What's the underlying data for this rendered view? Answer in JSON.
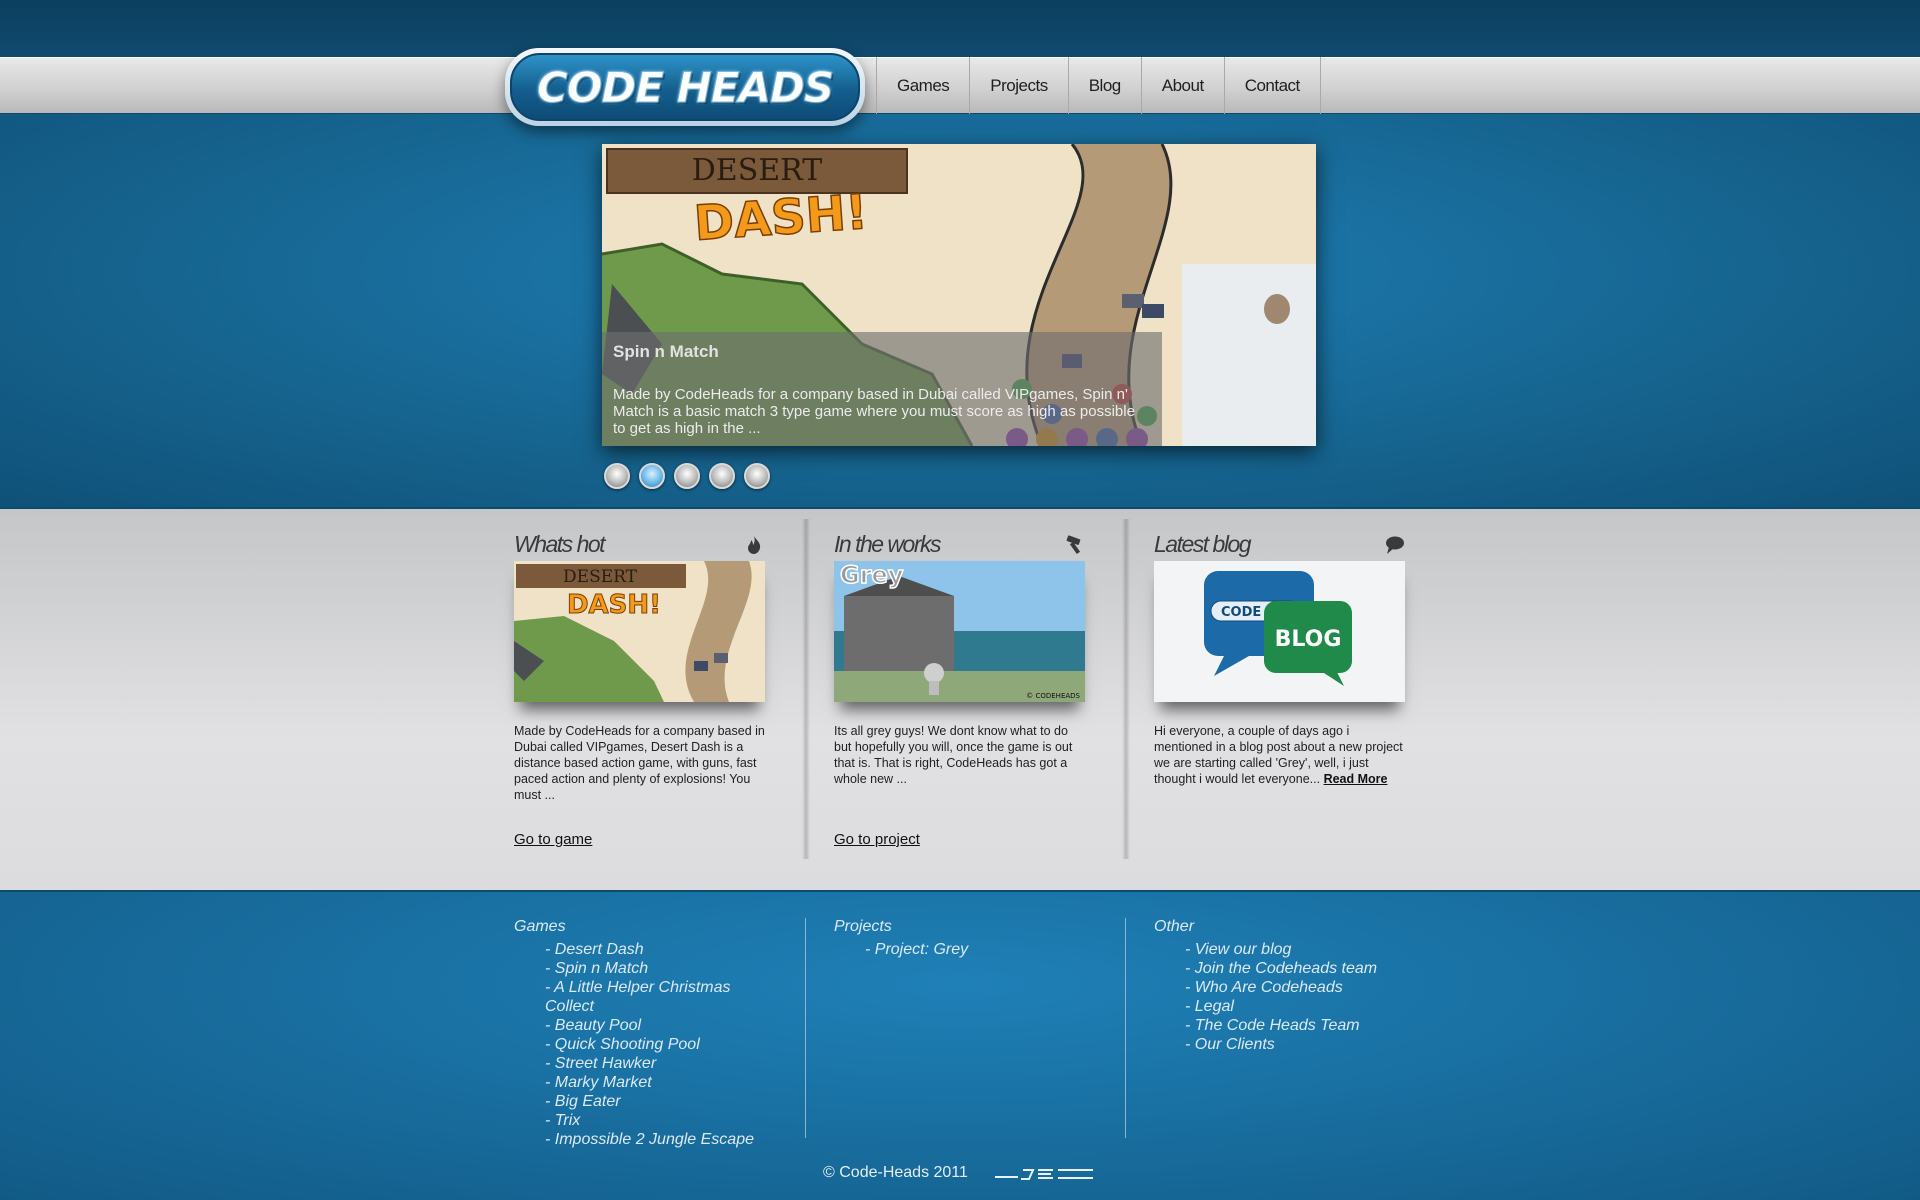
{
  "site": {
    "logo_text": "CODE HEADS"
  },
  "nav": [
    {
      "label": "Games"
    },
    {
      "label": "Projects"
    },
    {
      "label": "Blog"
    },
    {
      "label": "About"
    },
    {
      "label": "Contact"
    }
  ],
  "slider": {
    "image_title_1": "DESERT",
    "image_title_2": "DASH!",
    "caption_title": "Spin n Match",
    "caption_desc": "Made by CodeHeads for a company based in Dubai called VIPgames, Spin n' Match is a basic match 3 type game where you must score as high as possible to get as high in the ...",
    "dot_count": 5,
    "active_dot_index": 1
  },
  "columns": [
    {
      "title": "Whats hot",
      "icon": "flame-icon",
      "thumb_text_1": "DESERT",
      "thumb_text_2": "DASH!",
      "text": "Made by CodeHeads for a company based in Dubai called VIPgames, Desert Dash is a distance based action game, with guns, fast paced action and plenty of explosions! You must ...",
      "link": "Go to game"
    },
    {
      "title": "In the works",
      "icon": "hammer-icon",
      "thumb_text": "Grey",
      "thumb_credit": "© CODEHEADS",
      "text": "Its all grey guys! We dont know what to do but hopefully you will, once the game is out that is. That is right, CodeHeads has got a whole new ...",
      "link": "Go to project"
    },
    {
      "title": "Latest blog",
      "icon": "speech-bubble-icon",
      "thumb_text_1": "CODE H",
      "thumb_text_2": "BLOG",
      "text": "Hi everyone, a couple of days ago i mentioned in a blog post about a new project we are starting called 'Grey', well, i just thought i would let everyone...",
      "read_more": "Read More"
    }
  ],
  "footer": {
    "games": {
      "title": "Games",
      "items": [
        "- Desert Dash",
        "- Spin n Match",
        "- A Little Helper Christmas Collect",
        "- Beauty Pool",
        "- Quick Shooting Pool",
        "- Street Hawker",
        "- Marky Market",
        "- Big Eater",
        "- Trix",
        "- Impossible 2 Jungle Escape"
      ]
    },
    "projects": {
      "title": "Projects",
      "items": [
        "- Project: Grey"
      ]
    },
    "other": {
      "title": "Other",
      "items": [
        "- View our blog",
        "- Join the Codeheads team",
        "- Who Are Codeheads",
        "- Legal",
        "- The Code Heads Team",
        "- Our Clients"
      ]
    },
    "copyright": "© Code-Heads 2011"
  }
}
